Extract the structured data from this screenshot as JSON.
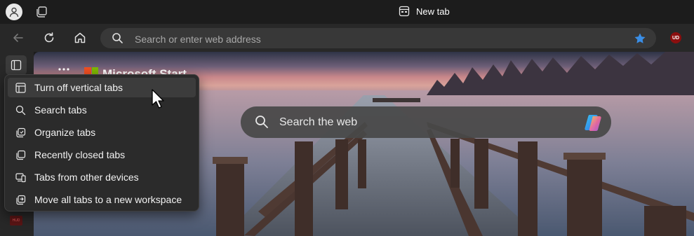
{
  "titlebar": {
    "tab_title": "New tab",
    "icons": {
      "profile": "profile-icon",
      "workspaces": "workspaces-icon",
      "tab": "new-tab-page-icon"
    }
  },
  "toolbar": {
    "address_placeholder": "Search or enter web address",
    "extension_badge": "UD",
    "icons": [
      "back-icon",
      "refresh-icon",
      "home-icon",
      "search-icon",
      "favorites-star-icon"
    ]
  },
  "sidebar": {
    "favorite_badge": "HUD"
  },
  "content": {
    "brand": "Microsoft Start",
    "search_label": "Search the web",
    "colors": {
      "ms_red": "#f25022",
      "ms_green": "#7fba00",
      "ms_blue": "#00a4ef",
      "ms_yellow": "#ffb900"
    }
  },
  "menu": {
    "items": [
      {
        "label": "Turn off vertical tabs",
        "icon": "vertical-tabs-off-icon",
        "highlighted": true
      },
      {
        "label": "Search tabs",
        "icon": "search-icon",
        "highlighted": false
      },
      {
        "label": "Organize tabs",
        "icon": "organize-tabs-icon",
        "highlighted": false
      },
      {
        "label": "Recently closed tabs",
        "icon": "recently-closed-icon",
        "highlighted": false
      },
      {
        "label": "Tabs from other devices",
        "icon": "devices-icon",
        "highlighted": false
      },
      {
        "label": "Move all tabs to a new workspace",
        "icon": "workspace-move-icon",
        "highlighted": false
      }
    ]
  },
  "accent_color": "#3a8ee6"
}
